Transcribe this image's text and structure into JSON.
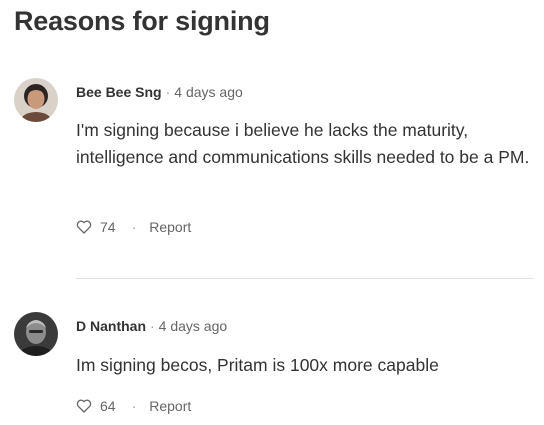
{
  "section": {
    "title": "Reasons for signing"
  },
  "comments": [
    {
      "author": "Bee Bee Sng",
      "separator": "·",
      "time": "4 days ago",
      "text": "I'm signing because i believe he lacks the maturity, intelligence and communications skills needed to be a PM.",
      "likes": "74",
      "report_label": "Report",
      "action_separator": "·",
      "icons": {
        "like": "heart-outline-icon"
      }
    },
    {
      "author": "D Nanthan",
      "separator": "·",
      "time": "4 days ago",
      "text": "Im signing becos, Pritam is 100x more capable",
      "likes": "64",
      "report_label": "Report",
      "action_separator": "·",
      "icons": {
        "like": "heart-outline-icon"
      }
    }
  ],
  "colors": {
    "text": "#333333",
    "muted": "#666666",
    "divider": "#e2e2e2"
  }
}
